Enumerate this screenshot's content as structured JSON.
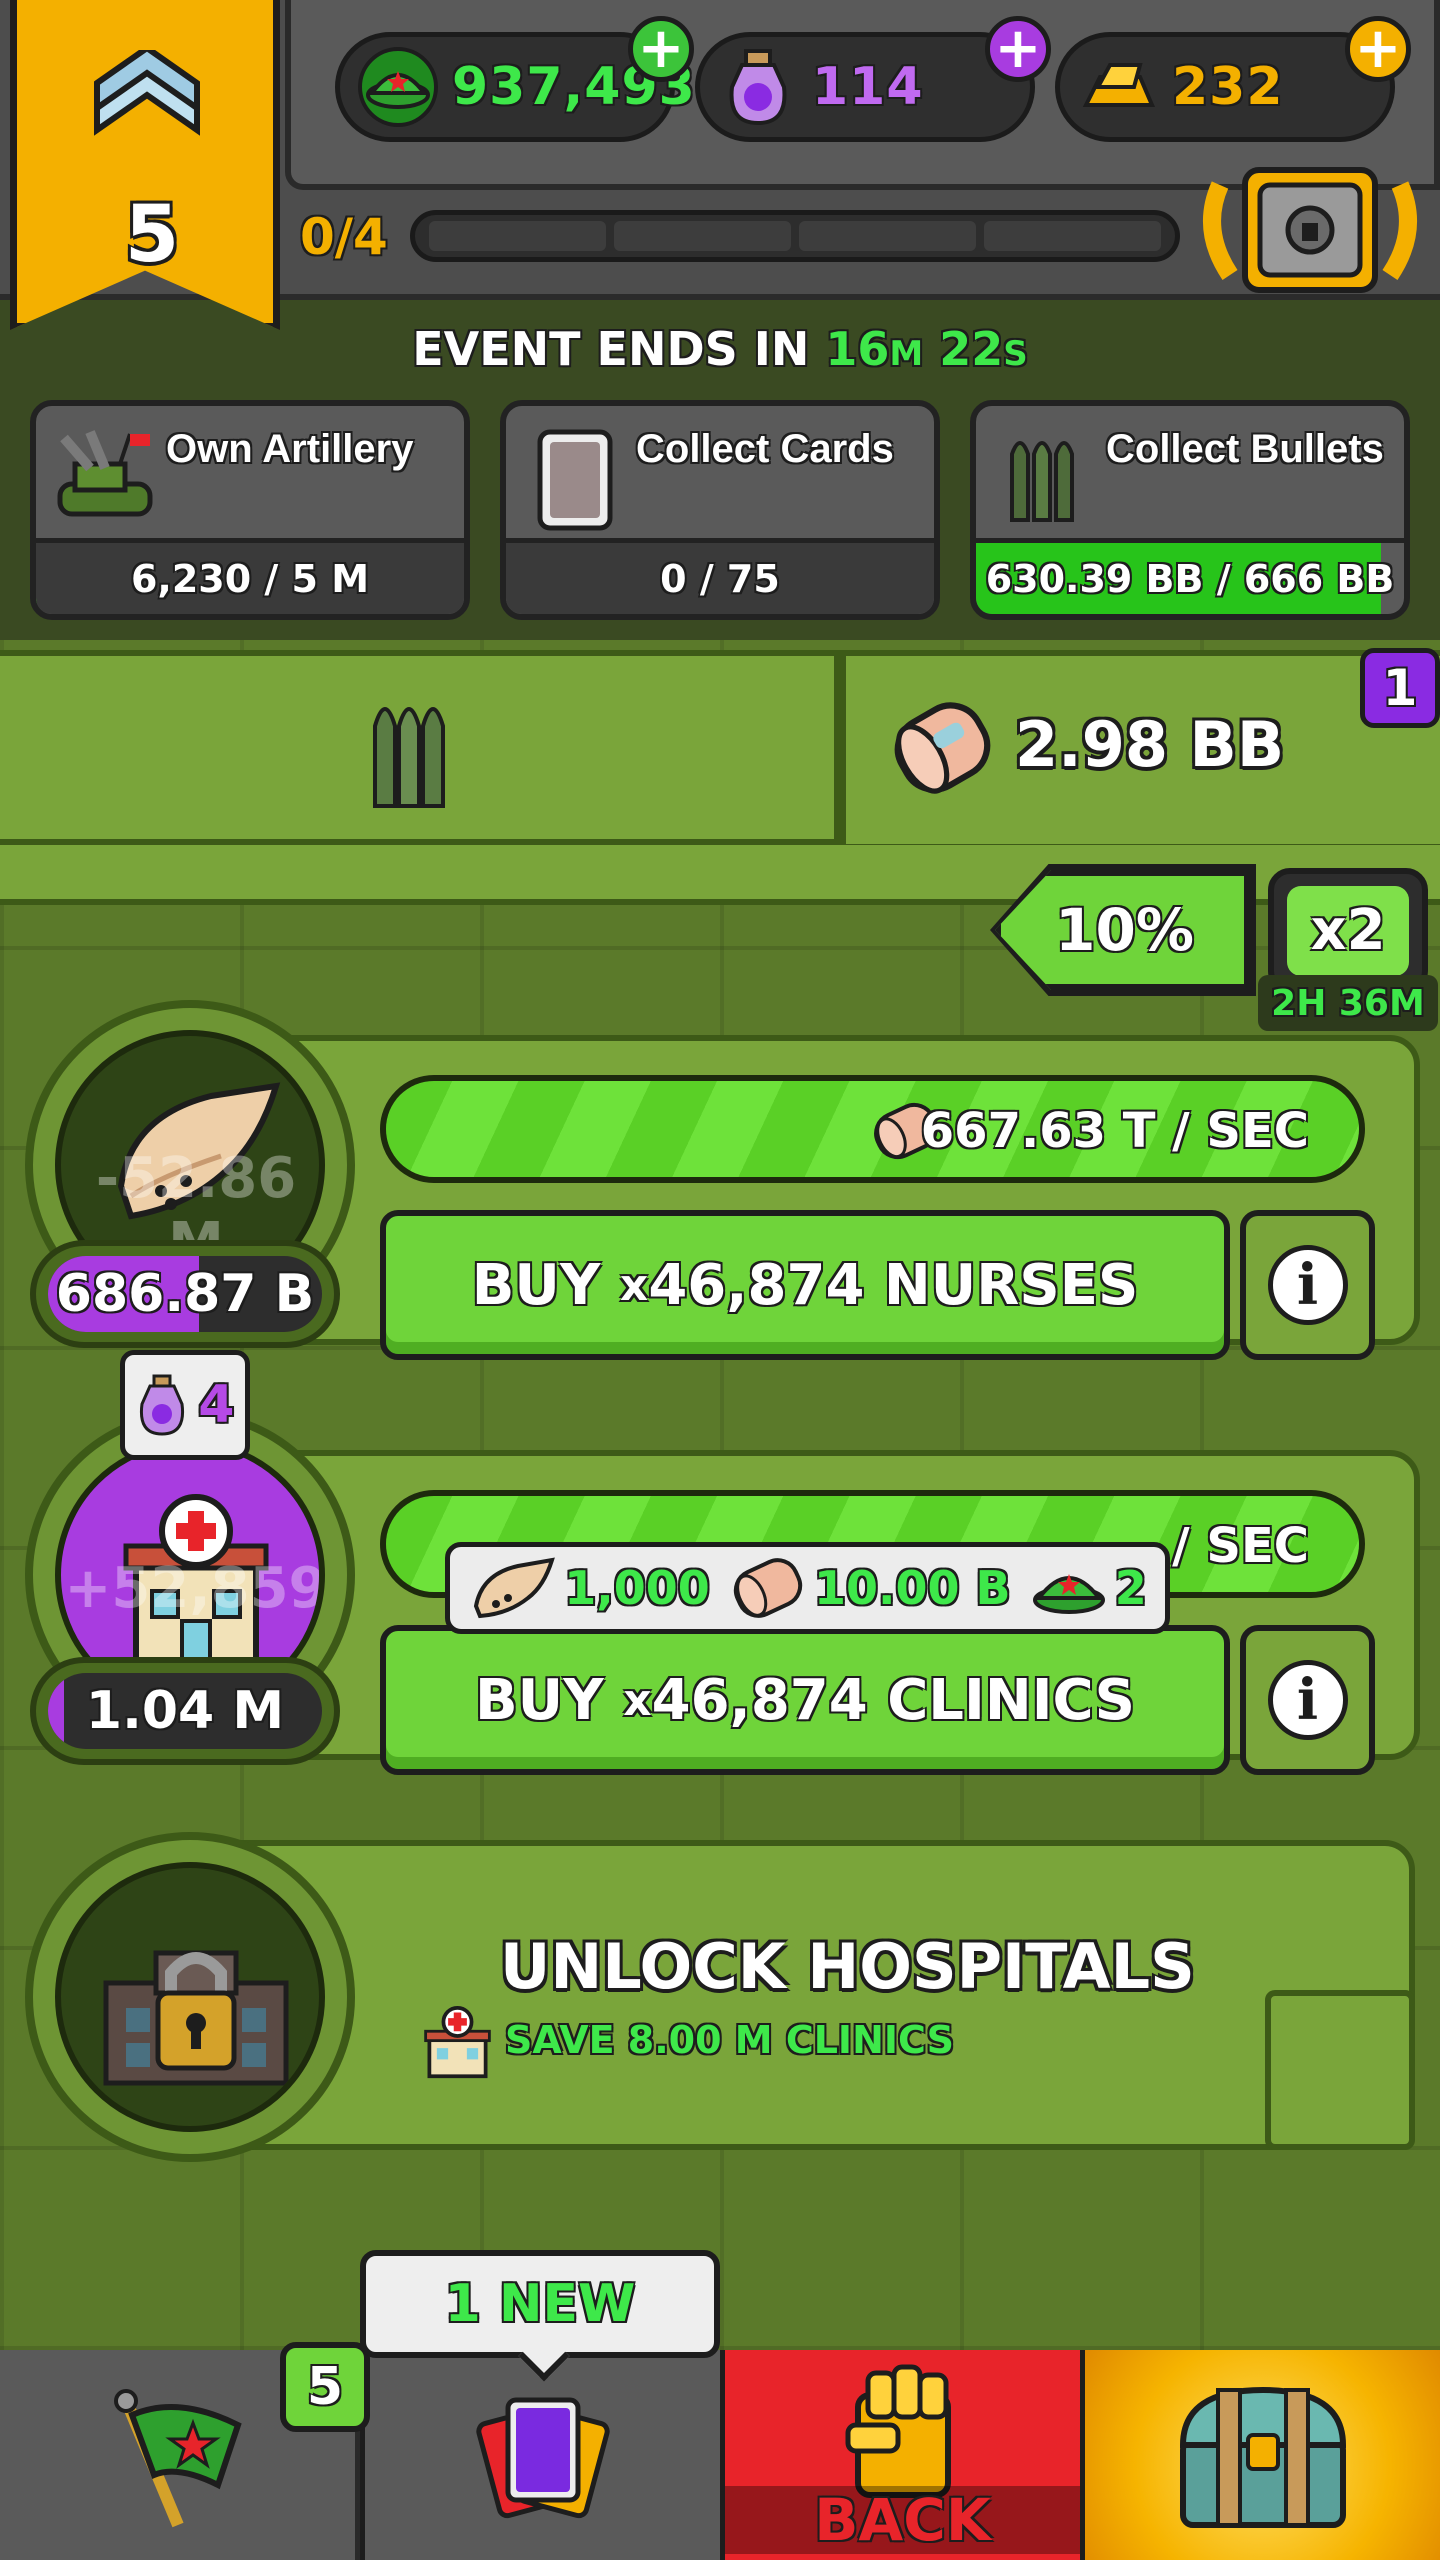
{
  "header": {
    "rank": "5",
    "currencies": {
      "medals": "937,493",
      "potions": "114",
      "gold": "232"
    },
    "rank_progress": "0/4",
    "rank_progress_fraction": 0
  },
  "event": {
    "label": "EVENT ENDS IN",
    "minutes": "16",
    "minutes_unit": "M",
    "seconds": "22",
    "seconds_unit": "S",
    "tasks": [
      {
        "title": "Own Artillery",
        "progress": "6,230 / 5 M",
        "fraction": 0.0012
      },
      {
        "title": "Collect Cards",
        "progress": "0 / 75",
        "fraction": 0
      },
      {
        "title": "Collect Bullets",
        "progress": "630.39 BB / 666 BB",
        "fraction": 0.947
      }
    ]
  },
  "resource": {
    "bandage_total": "2.98 BB",
    "badge": "1",
    "boost_percent": "10%",
    "multiplier": "x2",
    "multiplier_time": "2H 36M"
  },
  "generators": [
    {
      "ghost_value": "-52.86 M",
      "count": "686.87 B",
      "count_fraction": 0.55,
      "rate": "667.63 T / SEC",
      "rate_fraction": 1.0,
      "buy_prefix": "BUY",
      "buy_mult": "x",
      "buy_label": "46,874 NURSES"
    },
    {
      "ghost_value": "+52,859",
      "cost_bubble": "4",
      "count": "1.04 M",
      "count_fraction": 0.06,
      "rate": "/ SEC",
      "rate_fraction": 1.0,
      "buy_prefix": "BUY",
      "buy_mult": "x",
      "buy_label": "46,874 CLINICS"
    }
  ],
  "tooltip": {
    "cost_1": "1,000",
    "cost_2": "10.00 B",
    "cost_3": "2"
  },
  "unlock": {
    "title": "UNLOCK HOSPITALS",
    "subtitle": "SAVE 8.00 M CLINICS"
  },
  "nav": {
    "missions_badge": "5",
    "cards_new": "1 NEW",
    "back_label": "BACK"
  },
  "colors": {
    "accent_green": "#3ee84a",
    "gold": "#f4b000",
    "purple": "#a83ce0",
    "back_red": "#e8242a"
  }
}
